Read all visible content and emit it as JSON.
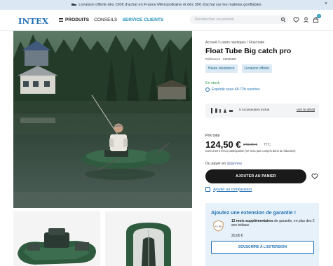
{
  "promo": {
    "text": "Livraison offerte dès 150€ d'achat en France Métropolitaine et dès 35€ d'achat sur les matelas gonflables",
    "close": "×"
  },
  "header": {
    "logo": "INTEX",
    "nav": {
      "products": "PRODUITS",
      "advice": "CONSEILS",
      "service": "SERVICE CLIENTS"
    },
    "search_placeholder": "Rechercher un produit",
    "cart_count": "0"
  },
  "product": {
    "breadcrumb": "Accueil  /  Loisirs nautiques  /  Float tube",
    "title": "Float Tube Big catch pro",
    "reference": "Référence : 68085NP",
    "tags": [
      "Haute résistance",
      "Livraison offerte"
    ],
    "stock": "En stock",
    "shipping": "Expédié sous 48-72h ouvrées",
    "accessories": {
      "text": "5 Accessoires inclus",
      "link": "Voir le détail"
    },
    "price_label": "Prix total",
    "price": "124,50 €",
    "old_price": "249,00 €",
    "ttc": "TTC",
    "eco": "Dont 3,59 € d'éco-participation (ne sera pas compris dans la réduction)",
    "pay_prefix": "Ou payer en",
    "oney": "◎◎oney",
    "add_to_cart": "AJOUTER AU PANIER",
    "compare": "Ajouter au comparateur"
  },
  "warranty": {
    "title": "Ajoutez une extension de garantie !",
    "badge": "+1 an",
    "bold": "12 mois supplémentaires",
    "text": " de garantie, en plus des 2 ans initiaux.",
    "price": "20,00 €",
    "button": "SOUSCRIRE À L'EXTENSION"
  },
  "colors": {
    "brand": "#1f6fb3",
    "service": "#1f8fb5",
    "stock": "#2e9e4f",
    "button": "#1a1a1a",
    "tag_bg": "#dbeaf4",
    "promo_bg": "#dbe8f4"
  },
  "icons": [
    "truck-icon",
    "close-icon",
    "menu-icon",
    "search-icon",
    "heart-icon",
    "user-icon",
    "bag-icon",
    "shipping-box-icon",
    "compare-icon",
    "warranty-shield-icon"
  ]
}
